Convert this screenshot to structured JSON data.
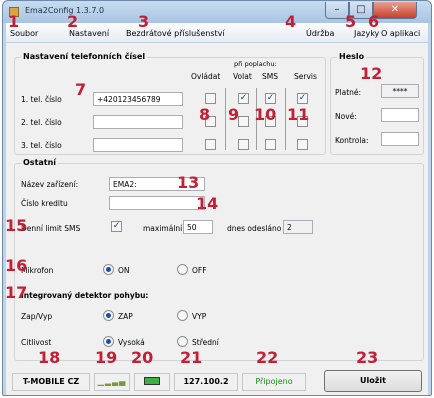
{
  "window": {
    "title": "Ema2Config 1.3.7.0"
  },
  "menu": {
    "items": [
      "Soubor",
      "Nastavení",
      "Bezdrátové příslušenství",
      "Údržba",
      "Jazyky",
      "O aplikaci"
    ]
  },
  "phones": {
    "group_title": "Nastavení telefonních čísel",
    "alarm_header": "při poplachu:",
    "columns": [
      "Ovládat",
      "Volat",
      "SMS",
      "Servis"
    ],
    "rows": [
      {
        "label": "1. tel. číslo",
        "value": "+420123456789",
        "checks": [
          false,
          true,
          true,
          true
        ]
      },
      {
        "label": "2. tel. číslo",
        "value": "",
        "checks": [
          false,
          false,
          false,
          false
        ]
      },
      {
        "label": "3. tel. číslo",
        "value": "",
        "checks": [
          false,
          false,
          false,
          false
        ]
      }
    ]
  },
  "password": {
    "group_title": "Heslo",
    "current_label": "Platné:",
    "current_value": "****",
    "new_label": "Nové:",
    "confirm_label": "Kontrola:"
  },
  "other": {
    "group_title": "Ostatní",
    "device_name_label": "Název zařízení:",
    "device_name_value": "EMA2:",
    "credit_label": "Číslo kreditu",
    "sms_limit_label": "Denní limit SMS",
    "sms_limit_checked": true,
    "max_label": "maximální",
    "max_value": "50",
    "sent_today_label": "dnes odesláno",
    "sent_today_value": "2",
    "mic_label": "Mikrofon",
    "mic_on": "ON",
    "mic_off": "OFF",
    "motion_title": "Integrovaný detektor pohybu:",
    "motion_switch_label": "Zap/Vyp",
    "motion_on": "ZAP",
    "motion_off": "VYP",
    "sensitivity_label": "Citlivost",
    "sens_high": "Vysoká",
    "sens_mid": "Střední"
  },
  "status": {
    "operator": "T-MOBILE CZ",
    "credit": "127.100.2",
    "connection": "Připojeno",
    "connection_color": "#1a8c1a",
    "battery_color": "#3cb043",
    "save_label": "Uložit"
  },
  "callouts": [
    "1",
    "2",
    "3",
    "4",
    "5",
    "6",
    "7",
    "8",
    "9",
    "10",
    "11",
    "12",
    "13",
    "14",
    "15",
    "16",
    "17",
    "18",
    "19",
    "20",
    "21",
    "22",
    "23"
  ],
  "colors": {
    "callout": "#c31f35"
  }
}
